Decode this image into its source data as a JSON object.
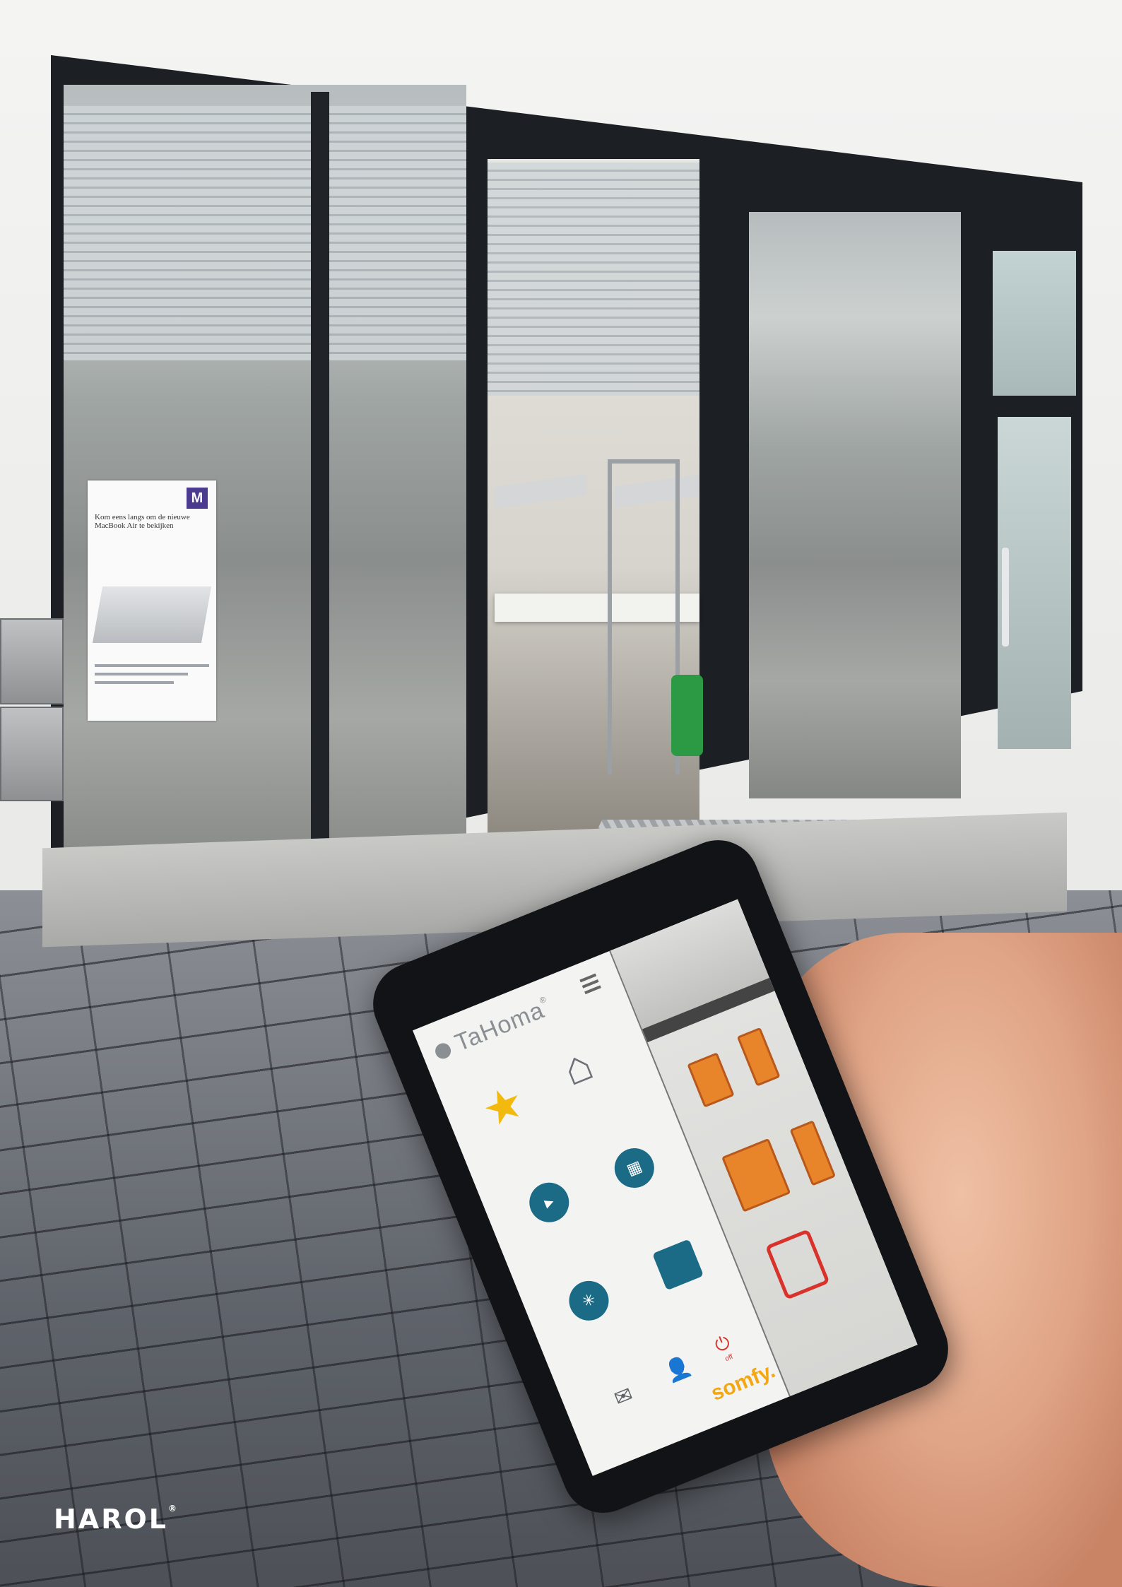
{
  "brand": {
    "name": "HAROL",
    "registered": "®"
  },
  "phone_app": {
    "app_name": "TaHoma",
    "registered": "®",
    "maker": "somfy.",
    "icons": [
      "tahoma-logo-icon",
      "menu-icon",
      "star-icon",
      "home-icon",
      "play-icon",
      "calendar-icon",
      "network-icon",
      "list-icon",
      "mail-icon",
      "user-icon",
      "power-icon"
    ],
    "power_label": "off"
  },
  "poster": {
    "badge": "M",
    "headline": "Kom eens langs om de nieuwe MacBook Air te bekijken"
  },
  "colors": {
    "accent_blue": "#1b6b86",
    "star_yellow": "#f2b90f",
    "somfy_yellow": "#f3a712",
    "tile_orange": "#e8842a",
    "lock_red": "#d8322a"
  }
}
